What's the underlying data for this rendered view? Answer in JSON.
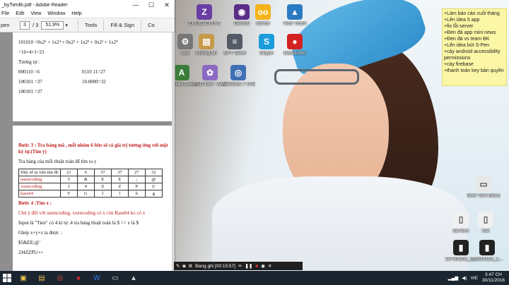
{
  "reader": {
    "title": "_byTienBi.pdf - Adobe Reader",
    "minimize": "—",
    "maximize": "☐",
    "close": "✕",
    "menu": [
      "File",
      "Edit",
      "View",
      "Window",
      "Help"
    ],
    "open_label": "pen",
    "page_current": "3",
    "page_total": "/ 3",
    "zoom": "51,9%",
    "tools_label": "Tools",
    "fill_sign_label": "Fill & Sign",
    "comment_label": "Co"
  },
  "page1": {
    "line1": "101010 =0x2⁵ + 1x2⁴ + 0x2³ + 1x2² + 0x2¹ + 1x2⁰",
    "line2": "=16+4+1=21",
    "line3": "Tương tự :",
    "r1a": "000110 =6",
    "r1b": "0110 11=27",
    "r2a": "100101 =37",
    "r2b": "10.0000=32",
    "r3a": "100101 =37"
  },
  "page2": {
    "step3": "Bước 3 : Tra bảng mã , mỗi nhóm 6 bits sẽ có giá trị tương ứng với một ký tự.(Tìm y)",
    "step3_sub": "Tra bảng của mỗi thuật toán để tìm ra y",
    "table": [
      [
        "Dãy số ta vừa tìm đc",
        "21",
        "6",
        "37",
        "37",
        "27",
        "32"
      ],
      [
        "uuencoding",
        "5",
        "&",
        "E",
        "E",
        ";",
        "@"
      ],
      [
        "xxencoding",
        "J",
        "4",
        "Z",
        "Z",
        "P",
        "U"
      ],
      [
        "base64",
        "V",
        "G",
        "l",
        "l",
        "b",
        "g"
      ]
    ],
    "step4": "Bước 4 :Tìm x :",
    "step4_note": "Chú ý đổi với uuencoding, xxencoding có x còn Base64 ko có x",
    "input_line": "Input là \"Tien\" có 4 kí tự .4 tra bảng thuật toán là $ => x là $",
    "combine": "Ghép x+y+z ta được :",
    "res1": "$5&EE;@`",
    "res2": "2J4ZZPU++"
  },
  "sticky": {
    "lines": [
      "+Làm báo cáo cuối tháng",
      "+Lên idea 5 app",
      "+fix lỗi server",
      "+Đen đá app mini news",
      "+Đen đá vs team BK",
      "+Lên idea bút S-Pen",
      "+cày android accessibility",
      "permissions",
      "+cày firebase",
      "+thanh toán key bản quyền"
    ]
  },
  "desktop_icons": [
    {
      "label": "CPUID CPU-Z",
      "icon": "cpu-z-icon",
      "color": "#6a3fa3",
      "glyph": "Z"
    },
    {
      "label": "GitHub",
      "icon": "github-icon",
      "color": "#5b2d86",
      "glyph": "◉"
    },
    {
      "label": "oovoo",
      "icon": "oovoo-icon",
      "color": "#f5b31b",
      "glyph": "oo"
    },
    {
      "label": "Vine Team",
      "icon": "vine-icon",
      "color": "#2a7ac2",
      "glyph": "▲"
    },
    {
      "label": "tool",
      "icon": "tool-icon",
      "color": "#777777",
      "glyph": "⚙"
    },
    {
      "label": "Không tin",
      "icon": "folder-icon",
      "color": "#c79a4a",
      "glyph": "▤"
    },
    {
      "label": "SPT Steel",
      "icon": "steel-icon",
      "color": "#555b66",
      "glyph": "≡"
    },
    {
      "label": "Skype",
      "icon": "skype-icon",
      "color": "#1b9ddb",
      "glyph": "S"
    },
    {
      "label": "Bandicam",
      "icon": "bandicam-icon",
      "color": "#d32121",
      "glyph": "●"
    },
    {
      "label": "Android Studio",
      "icon": "android-studio-icon",
      "color": "#3a7d3a",
      "glyph": "A"
    },
    {
      "label": "PSD tool - Shortcut",
      "icon": "psd-icon",
      "color": "#8b6ac2",
      "glyph": "✿"
    },
    {
      "label": "Windows 7 USB DVD",
      "icon": "usb-dvd-icon",
      "color": "#3f6fb5",
      "glyph": "◎"
    },
    {
      "label": "New Text Document",
      "icon": "text-document-icon",
      "color": "#e8e8e8",
      "glyph": "▭"
    },
    {
      "label": "du kien",
      "icon": "document-icon",
      "color": "#f0f0f0",
      "glyph": "▯"
    },
    {
      "label": "vltk",
      "icon": "file-icon",
      "color": "#f0f0f0",
      "glyph": "▯"
    },
    {
      "label": "14731366_1...",
      "icon": "image-file-icon",
      "color": "#222222",
      "glyph": "▮"
    },
    {
      "label": "13925118_1...",
      "icon": "image-file-icon",
      "color": "#222222",
      "glyph": "▮"
    }
  ],
  "recorder": {
    "status": "Đang ghi [00:15:57]"
  },
  "taskbar": {
    "items": [
      "windows-start-icon",
      "file-explorer-icon",
      "folder-icon",
      "chrome-icon",
      "acrobat-icon",
      "word-icon",
      "terminal-icon",
      "photos-icon"
    ],
    "lang": "VIE",
    "time": "3:47 CH",
    "date": "30/11/2016"
  }
}
